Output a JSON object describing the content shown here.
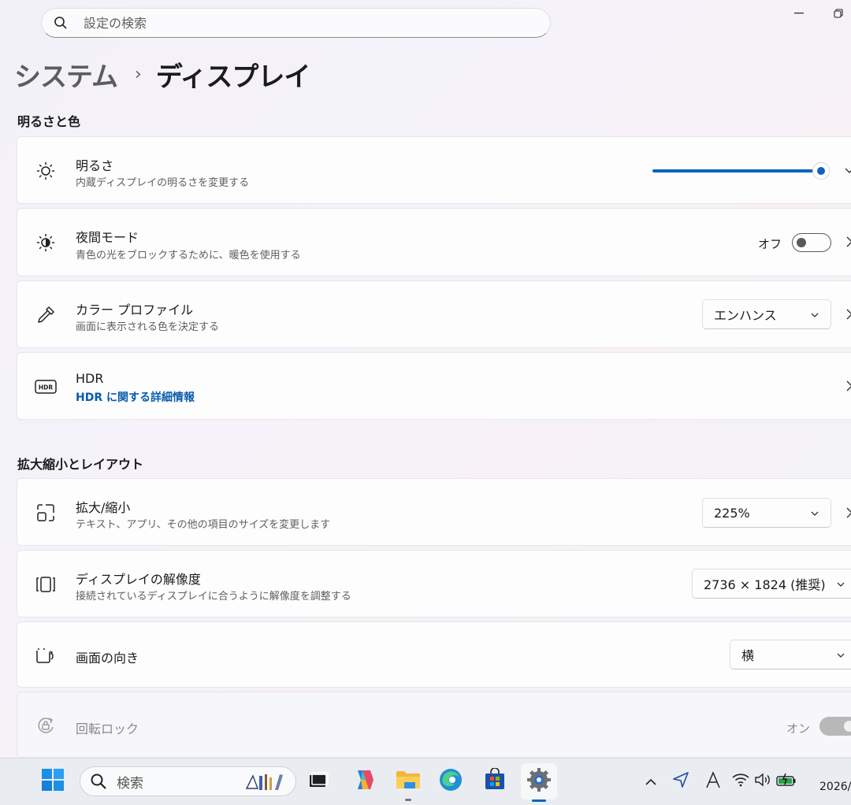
{
  "search": {
    "placeholder": "設定の検索"
  },
  "breadcrumb": {
    "parent": "システム",
    "separator": "›",
    "current": "ディスプレイ"
  },
  "sections": {
    "brightness_color": "明るさと色",
    "scale_layout": "拡大縮小とレイアウト"
  },
  "brightness": {
    "title": "明るさ",
    "subtitle": "内蔵ディスプレイの明るさを変更する",
    "level_percent": 100
  },
  "night_mode": {
    "title": "夜間モード",
    "subtitle": "青色の光をブロックするために、暖色を使用する",
    "state_label": "オフ"
  },
  "color_profile": {
    "title": "カラー プロファイル",
    "subtitle": "画面に表示される色を決定する",
    "value": "エンハンス"
  },
  "hdr": {
    "title": "HDR",
    "link": "HDR に関する詳細情報",
    "icon_text": "HDR"
  },
  "scale": {
    "title": "拡大/縮小",
    "subtitle": "テキスト、アプリ、その他の項目のサイズを変更します",
    "value": "225%"
  },
  "resolution": {
    "title": "ディスプレイの解像度",
    "subtitle": "接続されているディスプレイに合うように解像度を調整する",
    "value": "2736 × 1824 (推奨)"
  },
  "orientation": {
    "title": "画面の向き",
    "value": "横"
  },
  "rotation_lock": {
    "title": "回転ロック",
    "state_label": "オン"
  },
  "taskbar": {
    "search_label": "検索",
    "clock_partial": "2026/"
  },
  "colors": {
    "accent": "#0f62c0",
    "link": "#0b5cab"
  }
}
